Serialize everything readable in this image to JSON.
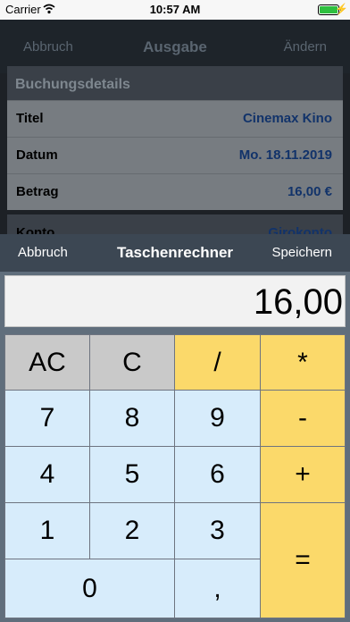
{
  "status_bar": {
    "carrier": "Carrier",
    "time": "10:57 AM"
  },
  "nav": {
    "left": "Abbruch",
    "title": "Ausgabe",
    "right": "Ändern"
  },
  "details": {
    "header": "Buchungsdetails",
    "rows": [
      {
        "label": "Titel",
        "value": "Cinemax Kino"
      },
      {
        "label": "Datum",
        "value": "Mo. 18.11.2019"
      },
      {
        "label": "Betrag",
        "value": "16,00 €"
      }
    ],
    "partial_row": {
      "label": "Konto",
      "value": "Girokonto"
    }
  },
  "calculator": {
    "toolbar": {
      "cancel": "Abbruch",
      "title": "Taschenrechner",
      "save": "Speichern"
    },
    "display": "16,00",
    "keys": {
      "ac": "AC",
      "c": "C",
      "div": "/",
      "mul": "*",
      "k7": "7",
      "k8": "8",
      "k9": "9",
      "sub": "-",
      "k4": "4",
      "k5": "5",
      "k6": "6",
      "add": "+",
      "k1": "1",
      "k2": "2",
      "k3": "3",
      "eq": "=",
      "k0": "0",
      "comma": ","
    }
  },
  "colors": {
    "gray_key": "#c9c9c9",
    "digit_key": "#d7ecfb",
    "operator_key": "#fbd96a",
    "toolbar": "#3c4753"
  }
}
